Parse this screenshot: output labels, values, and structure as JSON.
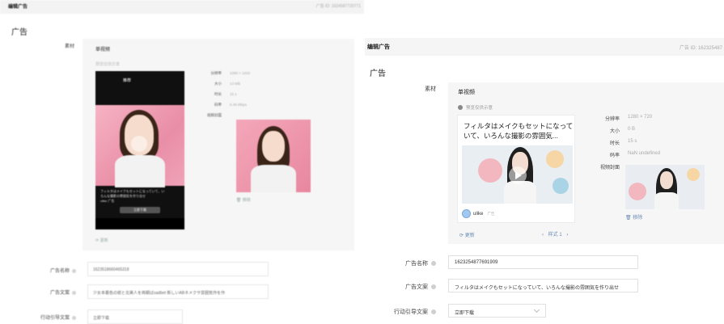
{
  "left_panel": {
    "title": "编辑广告",
    "ad_id": "广告 ID: 1624587720771",
    "section": "广告",
    "material_label": "素材",
    "material_type": "单视频",
    "preview_tip": "预览仅供示意",
    "phone_tab": "推荐",
    "phone_caption": "フィルタはメイクもセットになっていて、いろんな撮影の雰囲気を作り出せ",
    "phone_brand": "ulike 广告",
    "phone_button": "立即下载",
    "specs": [
      {
        "k": "分辨率",
        "v": "1080 × 1920"
      },
      {
        "k": "大小",
        "v": "13 MB"
      },
      {
        "k": "时长",
        "v": "15 s"
      },
      {
        "k": "码率",
        "v": "6.46 Mbps"
      },
      {
        "k": "视频封面",
        "v": ""
      }
    ],
    "remove": "移除",
    "update": "更新",
    "name_label": "广告名称",
    "name_value": "1623518660465318",
    "copy_label": "广告文案",
    "copy_value": "少女本着色の絵と北美人を両朝ばsadbet 新しいABネメクサ雰囲気作を作",
    "cta_label": "行动引导文案",
    "cta_value": "立即下载"
  },
  "right_panel": {
    "title": "编辑广告",
    "ad_id": "广告 ID: 162325487",
    "section": "广告",
    "material_label": "素材",
    "material_type": "单视频",
    "preview_tip": "预览仅供示意",
    "card_text": "フィルタはメイクもセットになっていて、いろんな撮影の雰囲気...",
    "brand_name": "ulike",
    "brand_tag": "广告",
    "specs": [
      {
        "k": "分辨率",
        "v": "1280 × 720"
      },
      {
        "k": "大小",
        "v": "0 B"
      },
      {
        "k": "时长",
        "v": "15 s"
      },
      {
        "k": "码率",
        "v": "NaN undefined"
      },
      {
        "k": "视频封面",
        "v": ""
      }
    ],
    "remove": "移除",
    "update": "更新",
    "style_label": "样式 1",
    "name_label": "广告名称",
    "name_value": "1623254877691909",
    "copy_label": "广告文案",
    "copy_value": "フィルタはメイクもセットになっていて、いろんな撮影の雰囲気を作り出せ",
    "cta_label": "行动引导文案",
    "cta_value": "立即下载"
  },
  "icons": {
    "help": "help-circle-icon",
    "update": "refresh-icon",
    "remove": "trash-icon",
    "prev": "chevron-left-icon",
    "next": "chevron-right-icon",
    "dropdown": "chevron-down-icon",
    "tip": "info-dot-icon",
    "play": "play-icon"
  },
  "colors": {
    "link": "#6a8bb3",
    "panel_bg": "#f6f6f6"
  }
}
